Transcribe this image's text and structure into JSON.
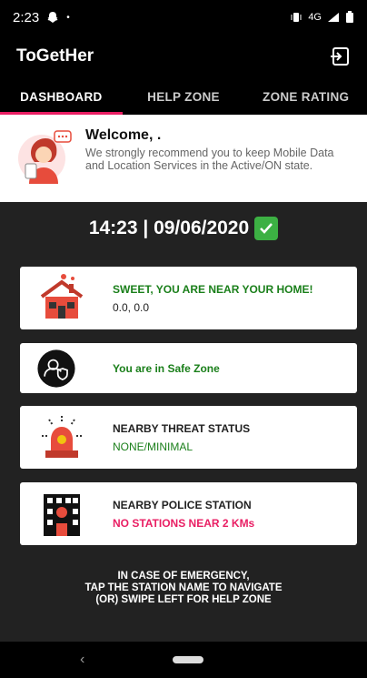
{
  "status": {
    "time": "2:23",
    "network": "4G"
  },
  "app": {
    "title": "ToGetHer"
  },
  "tabs": [
    {
      "label": "DASHBOARD",
      "active": true
    },
    {
      "label": "HELP ZONE",
      "active": false
    },
    {
      "label": "ZONE RATING",
      "active": false
    }
  ],
  "welcome": {
    "title": "Welcome, .",
    "message": "We strongly recommend you to keep Mobile Data and Location Services in the Active/ON state."
  },
  "datetime": "14:23 | 09/06/2020",
  "cards": {
    "home": {
      "title": "SWEET, YOU ARE NEAR YOUR HOME!",
      "coords": "0.0, 0.0",
      "title_color": "#1a7f1a"
    },
    "zone": {
      "title": "You are in Safe Zone",
      "title_color": "#1a7f1a"
    },
    "threat": {
      "title": "NEARBY THREAT STATUS",
      "status": "NONE/MINIMAL",
      "status_color": "#1a7f1a"
    },
    "police": {
      "title": "NEARBY POLICE STATION",
      "status": "NO STATIONS NEAR 2 KMs",
      "status_color": "#e91e63"
    }
  },
  "footer": {
    "line1": "IN CASE OF EMERGENCY,",
    "line2": "TAP THE STATION NAME TO NAVIGATE",
    "line3": "(OR) SWIPE LEFT FOR HELP ZONE"
  },
  "colors": {
    "accent": "#e91e63",
    "success": "#1a7f1a",
    "background": "#222222"
  }
}
